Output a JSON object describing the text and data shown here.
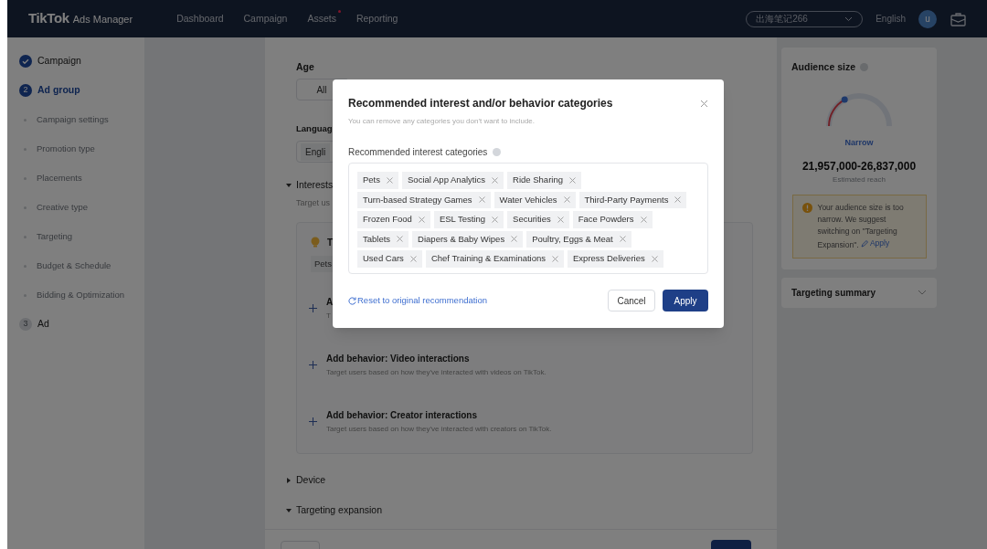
{
  "header": {
    "logo": "TikTok",
    "product": "Ads Manager",
    "nav": [
      {
        "label": "Dashboard",
        "badge": false
      },
      {
        "label": "Campaign",
        "badge": false
      },
      {
        "label": "Assets",
        "badge": true
      },
      {
        "label": "Reporting",
        "badge": false
      }
    ],
    "account": "出海笔记266",
    "language": "English",
    "avatar": "u"
  },
  "sidebar": {
    "steps": [
      {
        "label": "Campaign",
        "done": true,
        "selected": false
      },
      {
        "label": "Ad group",
        "done": false,
        "selected": true,
        "number": "2",
        "substeps": [
          "Campaign settings",
          "Promotion type",
          "Placements",
          "Creative type",
          "Targeting",
          "Budget & Schedule",
          "Bidding & Optimization"
        ]
      },
      {
        "label": "Ad",
        "done": false,
        "selected": false,
        "number": "3"
      }
    ]
  },
  "form": {
    "age": {
      "label": "Age",
      "options": [
        "All"
      ]
    },
    "language": {
      "label": "Languag",
      "value": "Engli"
    },
    "interests": {
      "title": "Interests",
      "expanded": true,
      "hint": "Target us",
      "recommended": {
        "title": "T",
        "tags": [
          "Pets"
        ]
      },
      "behaviors": [
        {
          "title": "A",
          "hint": "T"
        },
        {
          "title": "Add behavior: Video interactions",
          "hint": "Target users based on how they've interacted with videos on TikTok."
        },
        {
          "title": "Add behavior: Creator interactions",
          "hint": "Target users based on how they've interacted with creators on TikTok."
        }
      ]
    },
    "collapsibles": [
      {
        "title": "Device",
        "expanded": false
      },
      {
        "title": "Targeting expansion",
        "expanded": true
      }
    ]
  },
  "audience": {
    "title": "Audience size",
    "level": 0.26,
    "rating": "Narrow",
    "range": "21,957,000-26,837,000",
    "caption": "Estimated reach",
    "warning": "Your audience size is too narrow. We suggest switching on \"Targeting Expansion\".",
    "warning_action": "Apply",
    "summary": {
      "title": "Targeting summary",
      "expanded": false
    }
  },
  "dialog": {
    "title": "Recommended interest and/or behavior categories",
    "subtitle": "You can remove any categories you don't want to include.",
    "label": "Recommended interest categories",
    "tags": [
      "Pets",
      "Social App Analytics",
      "Ride Sharing",
      "Turn-based Strategy Games",
      "Water Vehicles",
      "Third-Party Payments",
      "Frozen Food",
      "ESL Testing",
      "Securities",
      "Face Powders",
      "Tablets",
      "Diapers & Baby Wipes",
      "Poultry, Eggs & Meat",
      "Used Cars",
      "Chef Training & Examinations",
      "Express Deliveries"
    ],
    "reset": "Reset to original recommendation",
    "buttons": [
      {
        "label": "Cancel",
        "primary": false
      },
      {
        "label": "Apply",
        "primary": true
      }
    ]
  }
}
